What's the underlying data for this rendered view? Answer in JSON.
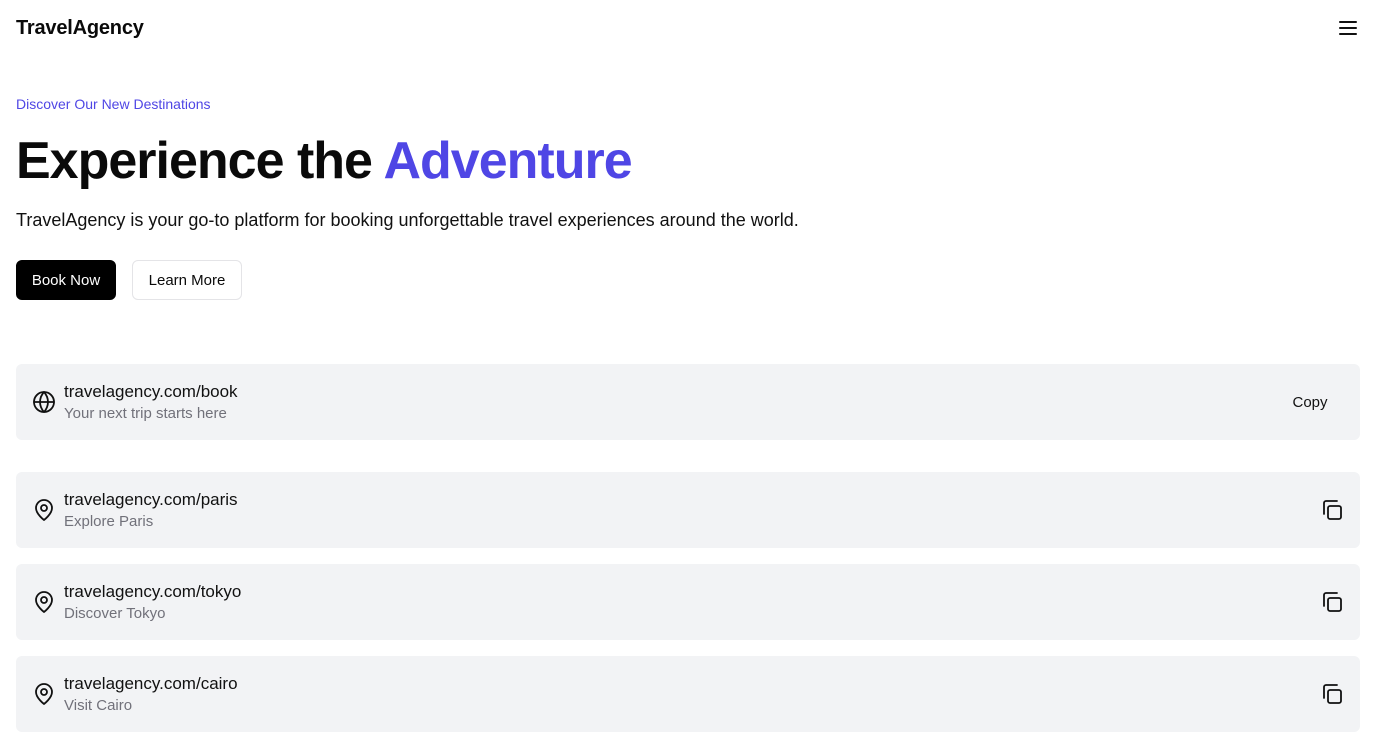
{
  "header": {
    "brand": "TravelAgency",
    "menu_icon": "hamburger-menu-icon"
  },
  "hero": {
    "eyebrow": "Discover Our New Destinations",
    "title_main": "Experience the ",
    "title_accent": "Adventure",
    "description": "TravelAgency is your go-to platform for booking unforgettable travel experiences around the world.",
    "primary_button": "Book Now",
    "secondary_button": "Learn More",
    "accent_color": "#4f46e5"
  },
  "featured_link": {
    "icon": "globe-icon",
    "url": "travelagency.com/book",
    "subtitle": "Your next trip starts here",
    "action_label": "Copy"
  },
  "destinations": [
    {
      "icon": "map-pin-icon",
      "url": "travelagency.com/paris",
      "subtitle": "Explore Paris",
      "action_icon": "copy-icon"
    },
    {
      "icon": "map-pin-icon",
      "url": "travelagency.com/tokyo",
      "subtitle": "Discover Tokyo",
      "action_icon": "copy-icon"
    },
    {
      "icon": "map-pin-icon",
      "url": "travelagency.com/cairo",
      "subtitle": "Visit Cairo",
      "action_icon": "copy-icon"
    }
  ]
}
